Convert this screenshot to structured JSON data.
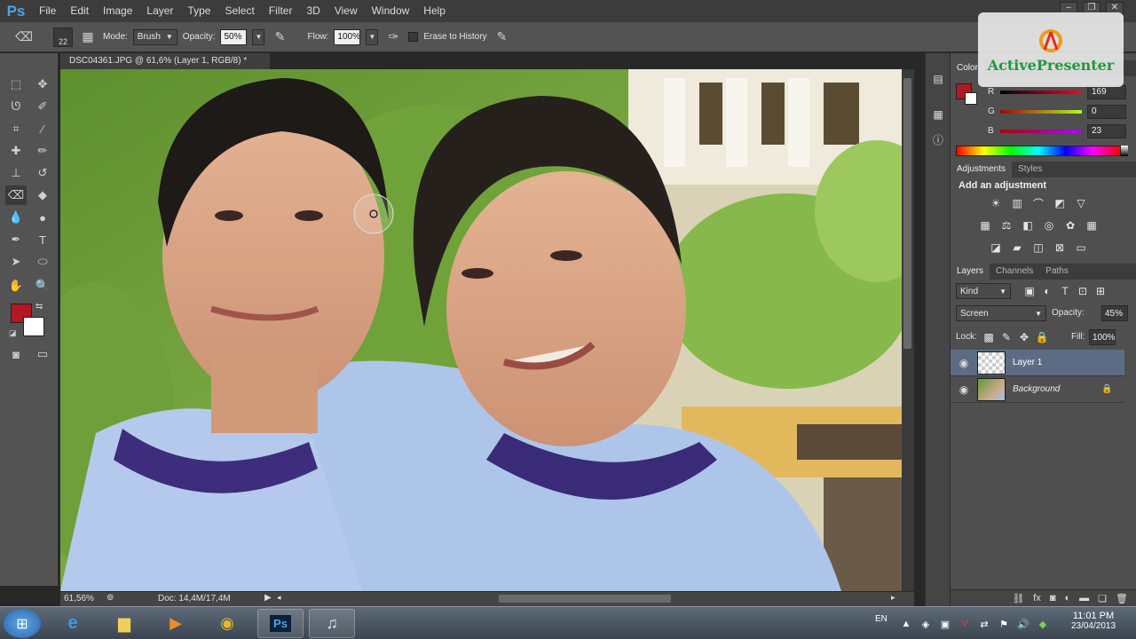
{
  "app": {
    "logo": "Ps"
  },
  "menu": [
    "File",
    "Edit",
    "Image",
    "Layer",
    "Type",
    "Select",
    "Filter",
    "3D",
    "View",
    "Window",
    "Help"
  ],
  "options": {
    "brush_size": "22",
    "mode_label": "Mode:",
    "mode_value": "Brush",
    "opacity_label": "Opacity:",
    "opacity_value": "50%",
    "flow_label": "Flow:",
    "flow_value": "100%",
    "erase_history_label": "Erase to History"
  },
  "document": {
    "tab_title": "DSC04361.JPG @ 61,6% (Layer 1, RGB/8) *",
    "zoom": "61,56%",
    "doc_info": "Doc: 14,4M/17,4M"
  },
  "color_panel": {
    "title": "Color",
    "fg_color": "#b31722",
    "r_label": "R",
    "r_value": "169",
    "g_label": "G",
    "g_value": "0",
    "b_label": "B",
    "b_value": "23"
  },
  "adjustments_panel": {
    "tabs": [
      "Adjustments",
      "Styles"
    ],
    "heading": "Add an adjustment"
  },
  "layers_panel": {
    "tabs": [
      "Layers",
      "Channels",
      "Paths"
    ],
    "filter_kind": "Kind",
    "blend_mode": "Screen",
    "opacity_label": "Opacity:",
    "opacity_value": "45%",
    "lock_label": "Lock:",
    "fill_label": "Fill:",
    "fill_value": "100%",
    "layers": [
      {
        "name": "Layer 1",
        "selected": true
      },
      {
        "name": "Background",
        "selected": false
      }
    ]
  },
  "watermark": {
    "text": "ActivePresenter"
  },
  "taskbar": {
    "language": "EN",
    "time": "11:01 PM",
    "date": "23/04/2013"
  }
}
